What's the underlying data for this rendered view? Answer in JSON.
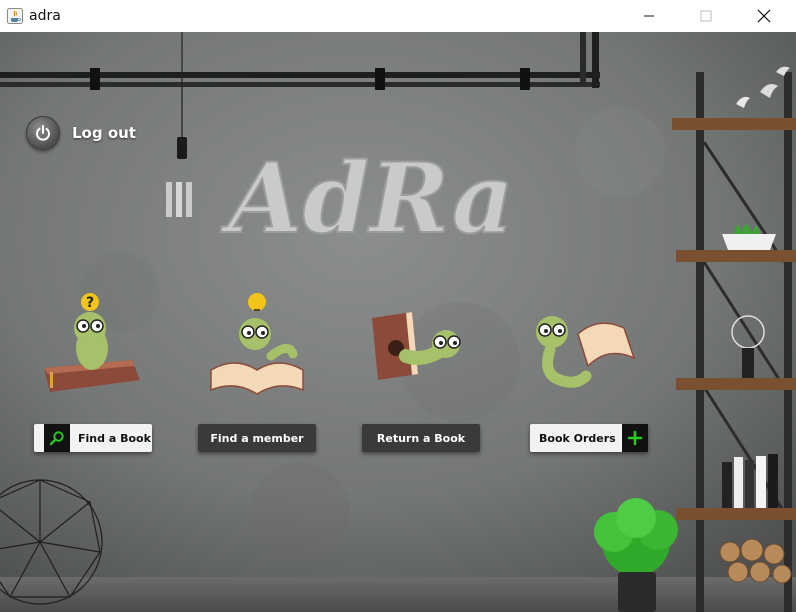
{
  "window": {
    "title": "adra"
  },
  "logout": {
    "label": "Log out"
  },
  "logo": {
    "text": "AdRa"
  },
  "buttons": {
    "find_book": "Find a Book",
    "find_member": "Find a member",
    "return_book": "Return a Book",
    "book_orders": "Book Orders"
  },
  "worm_marks": {
    "question": "?"
  },
  "colors": {
    "wall": "#777a78",
    "accent_green": "#27c91e",
    "button_dark": "#3a3a3a",
    "button_light": "#f2f2f2",
    "worm_green": "#a7c06a"
  }
}
